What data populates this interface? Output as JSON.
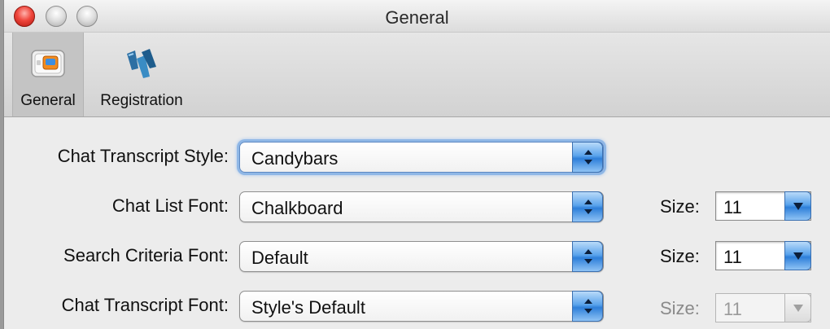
{
  "window": {
    "title": "General"
  },
  "toolbar": {
    "items": [
      {
        "label": "General",
        "icon": "general-prefs-icon",
        "selected": true
      },
      {
        "label": "Registration",
        "icon": "registration-logo-icon",
        "selected": false
      }
    ]
  },
  "form": {
    "transcript_style": {
      "label": "Chat Transcript Style:",
      "value": "Candybars"
    },
    "list_font": {
      "label": "Chat List Font:",
      "value": "Chalkboard",
      "size_label": "Size:",
      "size": "11"
    },
    "search_font": {
      "label": "Search Criteria Font:",
      "value": "Default",
      "size_label": "Size:",
      "size": "11"
    },
    "transcript_font": {
      "label": "Chat Transcript Font:",
      "value": "Style's Default",
      "size_label": "Size:",
      "size": "11",
      "size_enabled": false
    }
  },
  "colors": {
    "accent": "#2e7fd9",
    "close": "#f0473d"
  }
}
